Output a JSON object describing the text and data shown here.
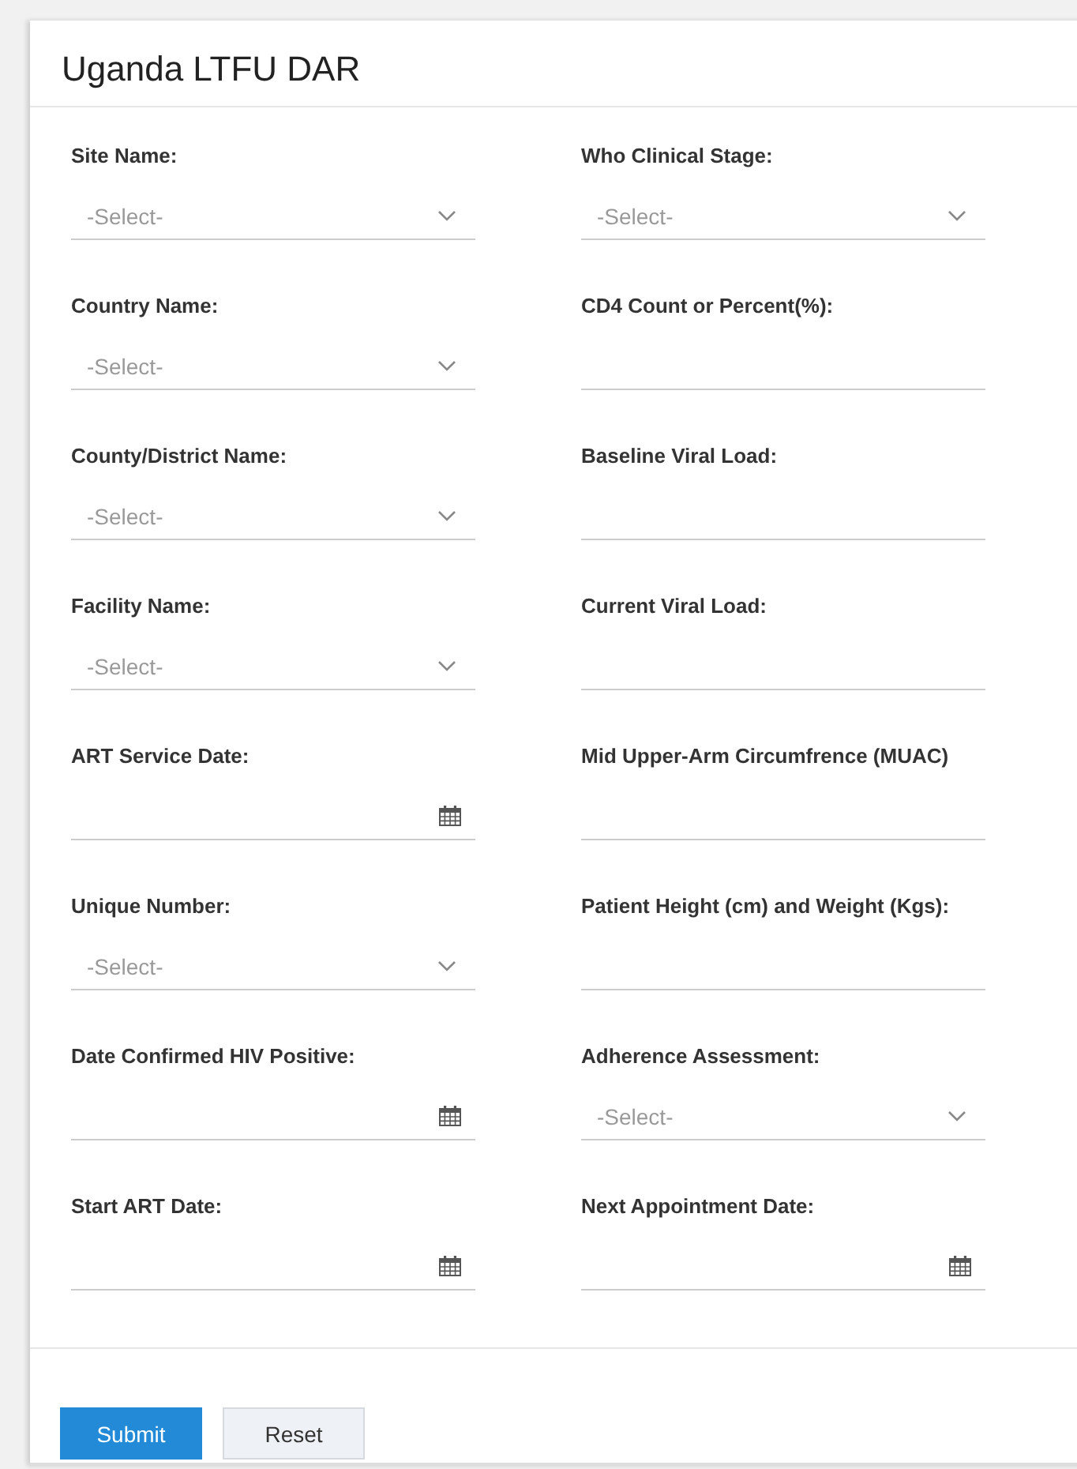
{
  "form": {
    "title": "Uganda LTFU DAR"
  },
  "fields": [
    {
      "label": "Site Name:",
      "kind": "select",
      "placeholder": "-Select-"
    },
    {
      "label": "Who Clinical Stage:",
      "kind": "select",
      "placeholder": "-Select-"
    },
    {
      "label": "Country Name:",
      "kind": "select",
      "placeholder": "-Select-"
    },
    {
      "label": "CD4 Count or Percent(%):",
      "kind": "text"
    },
    {
      "label": "County/District Name:",
      "kind": "select",
      "placeholder": "-Select-"
    },
    {
      "label": "Baseline Viral Load:",
      "kind": "text"
    },
    {
      "label": "Facility Name:",
      "kind": "select",
      "placeholder": "-Select-"
    },
    {
      "label": "Current Viral Load:",
      "kind": "text"
    },
    {
      "label": "ART Service Date:",
      "kind": "date"
    },
    {
      "label": "Mid Upper-Arm Circumfrence (MUAC)",
      "kind": "text"
    },
    {
      "label": "Unique Number:",
      "kind": "select",
      "placeholder": "-Select-"
    },
    {
      "label": "Patient Height (cm) and Weight (Kgs):",
      "kind": "text"
    },
    {
      "label": "Date Confirmed HIV Positive:",
      "kind": "date"
    },
    {
      "label": "Adherence Assessment:",
      "kind": "select",
      "placeholder": "-Select-"
    },
    {
      "label": "Start ART Date:",
      "kind": "date"
    },
    {
      "label": "Next Appointment Date:",
      "kind": "date"
    }
  ],
  "buttons": [
    {
      "label": "Submit",
      "kind": "primary"
    },
    {
      "label": "Reset",
      "kind": "secondary"
    }
  ]
}
